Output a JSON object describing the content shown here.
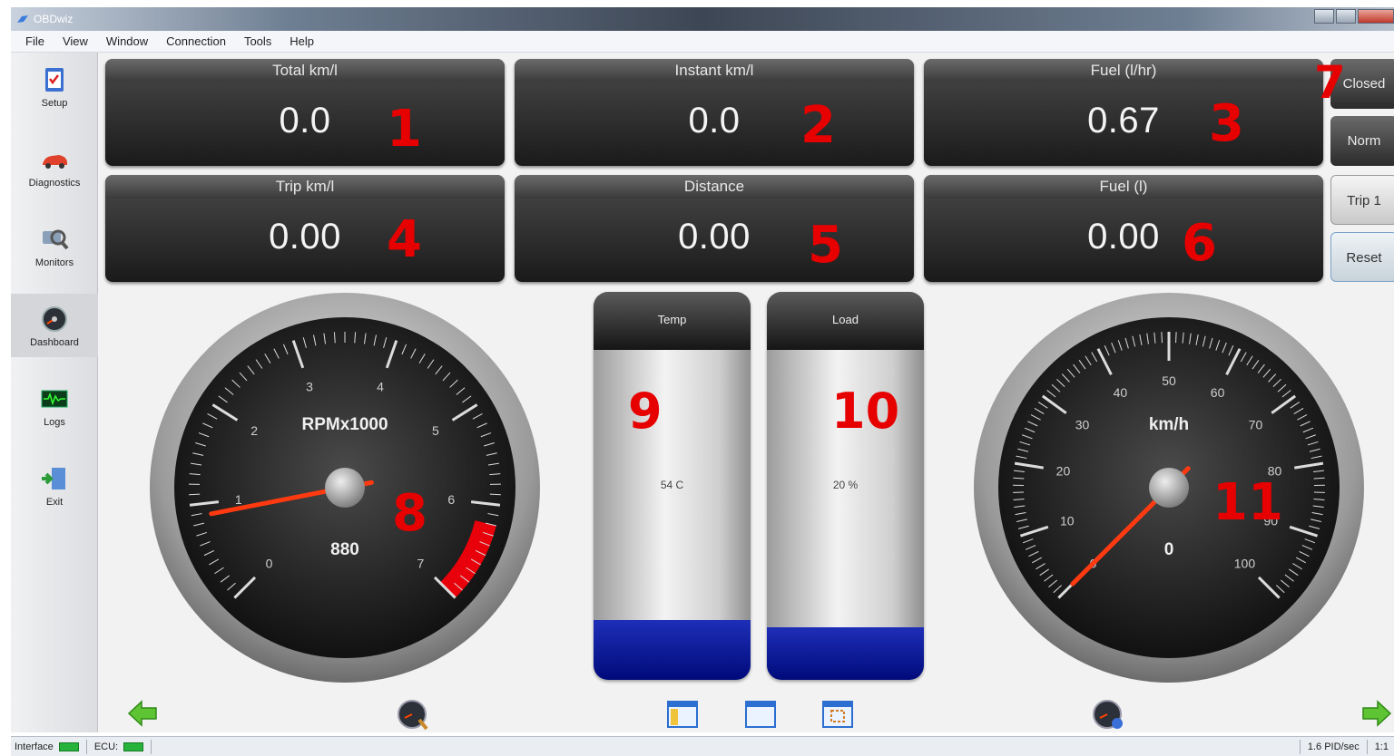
{
  "window": {
    "title": "OBDwiz"
  },
  "menu": [
    "File",
    "View",
    "Window",
    "Connection",
    "Tools",
    "Help"
  ],
  "sidebar": [
    {
      "label": "Setup",
      "icon": "setup-icon"
    },
    {
      "label": "Diagnostics",
      "icon": "car-icon"
    },
    {
      "label": "Monitors",
      "icon": "monitor-magnifier-icon"
    },
    {
      "label": "Dashboard",
      "icon": "gauge-icon",
      "active": true
    },
    {
      "label": "Logs",
      "icon": "waveform-icon"
    },
    {
      "label": "Exit",
      "icon": "exit-door-icon"
    }
  ],
  "tiles": [
    {
      "caption": "Total km/l",
      "value": "0.0",
      "number": "1"
    },
    {
      "caption": "Instant km/l",
      "value": "0.0",
      "number": "2"
    },
    {
      "caption": "Fuel (l/hr)",
      "value": "0.67",
      "number": "3"
    },
    {
      "caption": "Trip km/l",
      "value": "0.00",
      "number": "4"
    },
    {
      "caption": "Distance",
      "value": "0.00",
      "number": "5"
    },
    {
      "caption": "Fuel (l)",
      "value": "0.00",
      "number": "6"
    }
  ],
  "side_buttons": {
    "closed": "Closed",
    "norm": "Norm",
    "trip": "Trip 1",
    "reset": "Reset",
    "number": "7"
  },
  "rpm_gauge": {
    "title": "RPMx1000",
    "readout": "880",
    "ticks": [
      "0",
      "1",
      "2",
      "3",
      "4",
      "5",
      "6",
      "7"
    ],
    "max": 7,
    "value": 0.88,
    "redline_from": 6.2,
    "number": "8"
  },
  "temp_bar": {
    "caption": "Temp",
    "readout": "54 C",
    "level": 0.18,
    "number": "9"
  },
  "load_bar": {
    "caption": "Load",
    "readout": "20 %",
    "level": 0.16,
    "number": "10"
  },
  "speed_gauge": {
    "title": "km/h",
    "readout": "0",
    "ticks": [
      "0",
      "10",
      "20",
      "30",
      "40",
      "50",
      "60",
      "70",
      "80",
      "90",
      "100"
    ],
    "max": 100,
    "value": 0,
    "number": "11"
  },
  "colors": {
    "accent_red": "#e60000",
    "needle": "#ff3300",
    "bar_fill": "#0a1aa0",
    "led": "#27b33b"
  },
  "status": {
    "interface": "Interface",
    "ecu": "ECU:",
    "rate": "1.6 PID/sec",
    "time": "1:1"
  }
}
